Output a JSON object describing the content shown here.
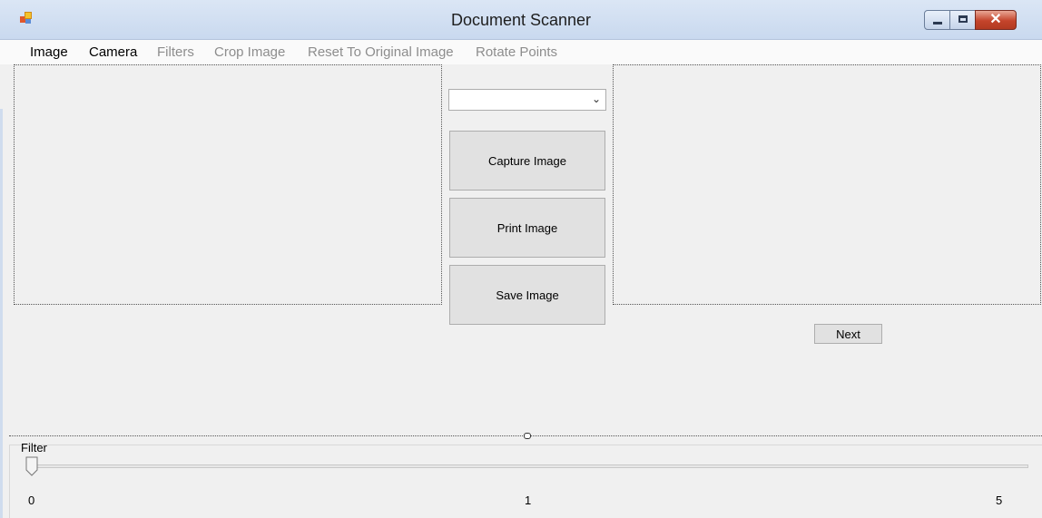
{
  "window": {
    "title": "Document Scanner",
    "controls": {
      "minimize": "minimize",
      "maximize": "maximize",
      "close": "✕"
    }
  },
  "menu": {
    "items": [
      {
        "label": "Image",
        "enabled": true
      },
      {
        "label": "Camera",
        "enabled": true
      },
      {
        "label": "Filters",
        "enabled": false
      },
      {
        "label": "Crop Image",
        "enabled": false
      },
      {
        "label": "Reset To Original Image",
        "enabled": false
      },
      {
        "label": "Rotate Points",
        "enabled": false
      }
    ]
  },
  "camera_select": {
    "value": "",
    "icon": "chevron-down-icon"
  },
  "buttons": {
    "capture": "Capture Image",
    "print": "Print Image",
    "save": "Save Image",
    "next": "Next"
  },
  "filter": {
    "label": "Filter",
    "min": 0,
    "max": 5,
    "value": 0,
    "ticks": [
      "0",
      "1",
      "5"
    ]
  },
  "colors": {
    "close_button": "#c4442b",
    "titlebar": "#dbe6f5",
    "window_bg": "#f0f0f0"
  }
}
